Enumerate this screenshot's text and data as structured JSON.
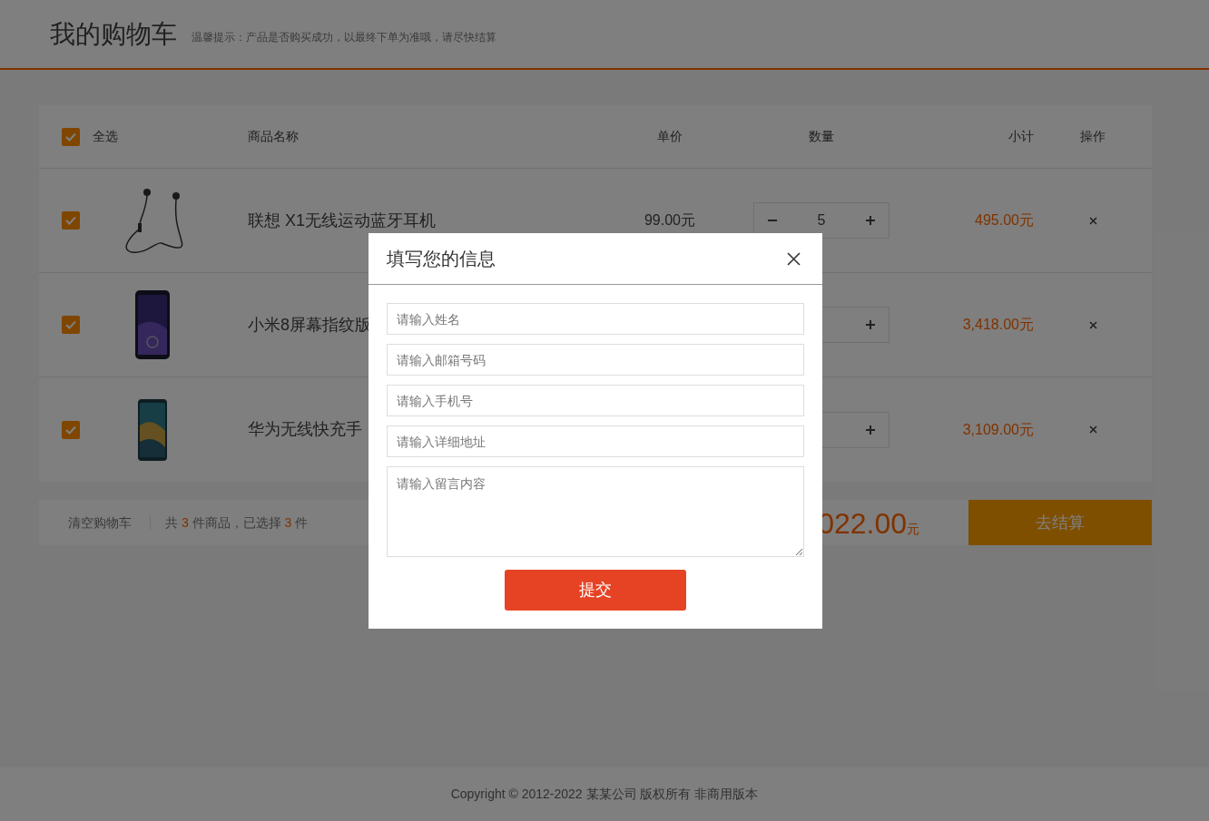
{
  "header": {
    "title": "我的购物车",
    "tip": "温馨提示：产品是否购买成功，以最终下单为准哦，请尽快结算"
  },
  "cart": {
    "select_all": {
      "label": "全选",
      "checked": true
    },
    "columns": [
      "商品名称",
      "单价",
      "数量",
      "小计",
      "操作"
    ],
    "items": [
      {
        "name": "联想 X1无线运动蓝牙耳机",
        "price": "99.00元",
        "quantity": "5",
        "subtotal": "495.00元",
        "checked": true
      },
      {
        "name": "小米8屏幕指纹版",
        "subtotal": "3,418.00元",
        "checked": true
      },
      {
        "name": "华为无线快充手",
        "subtotal": "3,109.00元",
        "checked": true
      }
    ]
  },
  "summary_bar": {
    "clear": "清空购物车",
    "count_prefix": "共",
    "count": "3",
    "count_mid": "件商品，已选择",
    "selected": "3",
    "count_suffix": "件",
    "total": "022.00",
    "currency": "元",
    "checkout": "去结算"
  },
  "modal": {
    "title": "填写您的信息",
    "fields": [
      {
        "kind": "input",
        "placeholder": "请输入姓名"
      },
      {
        "kind": "input",
        "placeholder": "请输入邮箱号码"
      },
      {
        "kind": "input",
        "placeholder": "请输入手机号"
      },
      {
        "kind": "input",
        "placeholder": "请输入详细地址"
      },
      {
        "kind": "textarea",
        "placeholder": "请输入留言内容"
      }
    ],
    "submit": "提交"
  },
  "footer": {
    "copyright": "Copyright © 2012-2022 某某公司 版权所有 非商用版本"
  }
}
